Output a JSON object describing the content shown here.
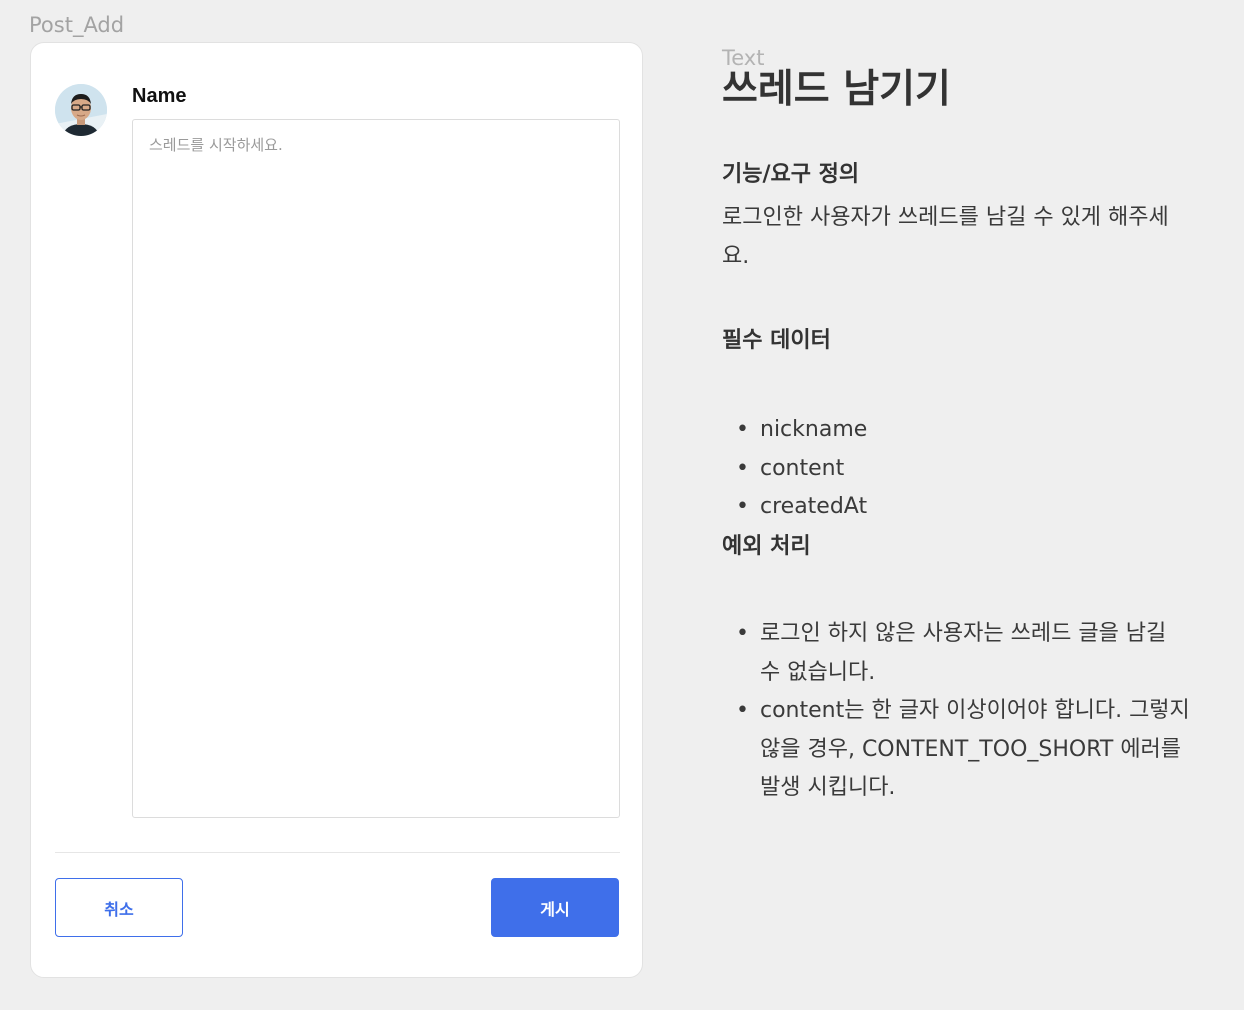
{
  "frame_label": "Post_Add",
  "composer": {
    "author_name": "Name",
    "textarea_placeholder": "스레드를 시작하세요.",
    "textarea_value": "",
    "cancel_label": "취소",
    "submit_label": "게시"
  },
  "spec": {
    "overline": "Text",
    "title": "쓰레드 남기기",
    "function_heading": "기능/요구 정의",
    "function_description": "로그인한 사용자가 쓰레드를 남길 수 있게 해주세요.",
    "data_heading": "필수 데이터",
    "data_items": [
      "nickname",
      "content",
      "createdAt"
    ],
    "exception_heading": "예외 처리",
    "exception_items": [
      "로그인 하지 않은 사용자는 쓰레드 글을 남길 수 없습니다.",
      "content는 한 글자 이상이어야 합니다. 그렇지 않을 경우, CONTENT_TOO_SHORT 에러를 발생 시킵니다."
    ]
  },
  "colors": {
    "accent": "#3f6fea",
    "background": "#efefef",
    "card": "#ffffff"
  },
  "icons": {
    "avatar": "user-avatar-photo"
  }
}
